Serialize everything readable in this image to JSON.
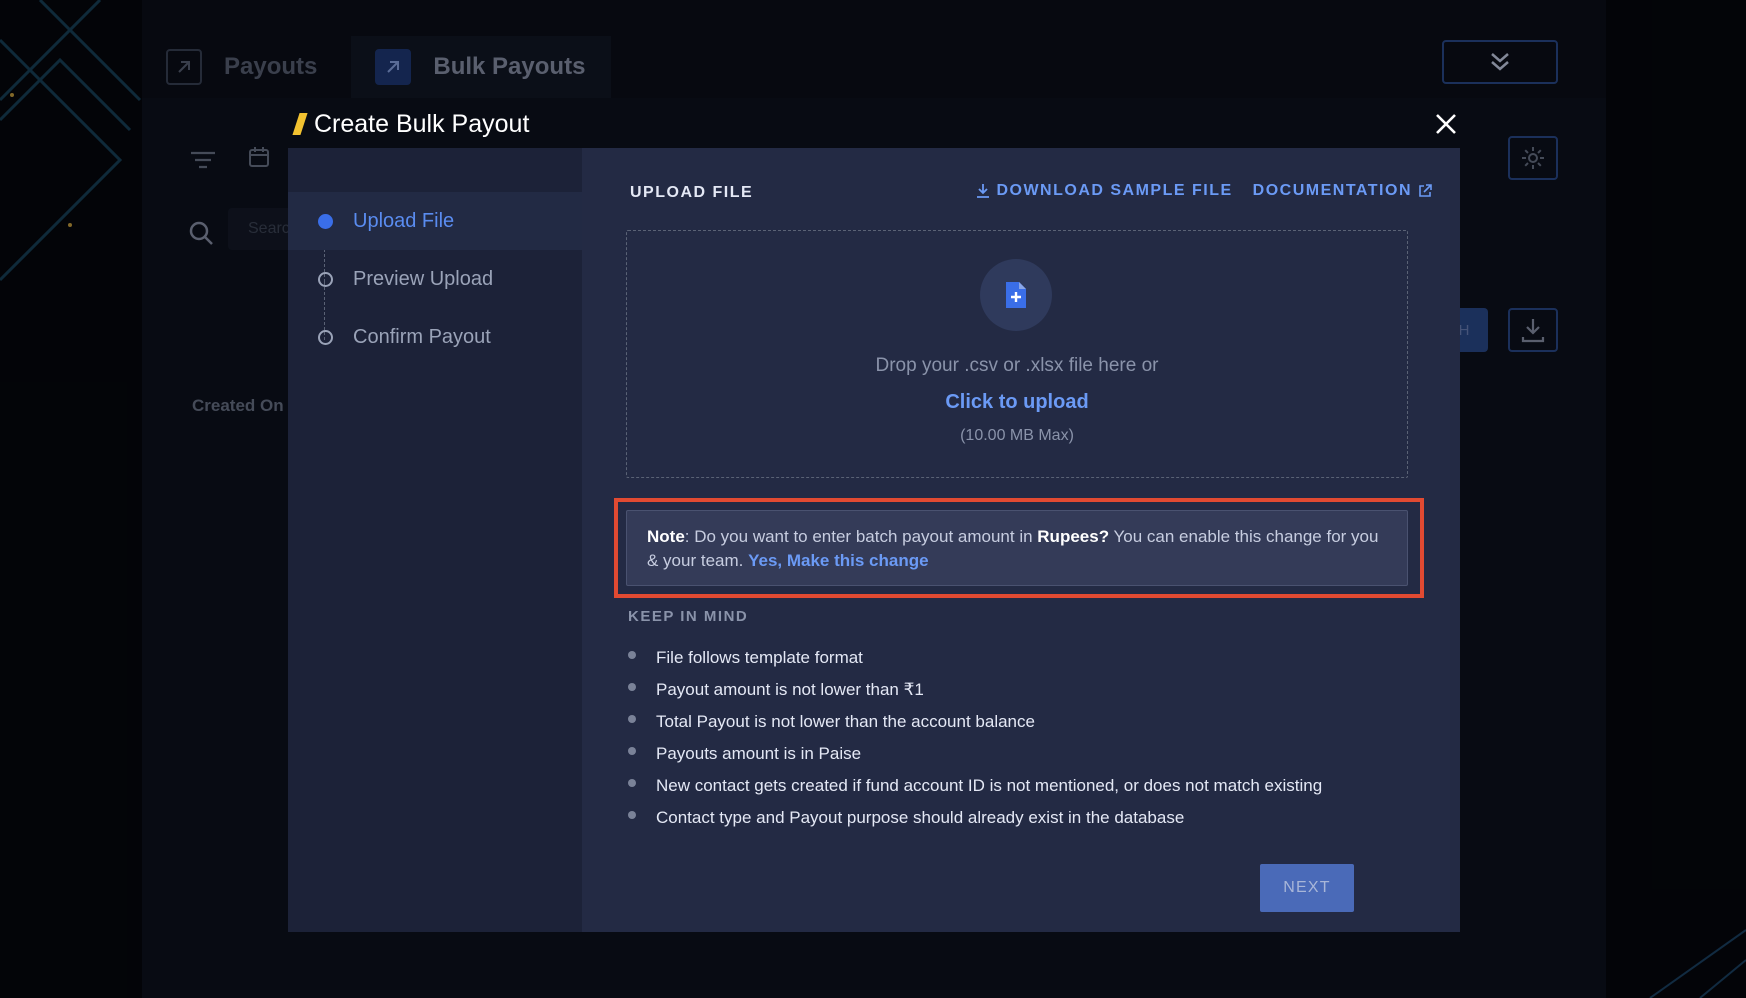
{
  "background": {
    "tabs": [
      {
        "label": "Payouts",
        "icon": "arrow-up-right-icon"
      },
      {
        "label": "Bulk Payouts",
        "icon": "arrow-up-right-icon"
      }
    ],
    "search_placeholder": "Search",
    "created_on_label": "Created On",
    "blue_button_fragment": "H"
  },
  "modal": {
    "title": "Create Bulk Payout",
    "accent_color": "#f2c230",
    "steps": [
      {
        "label": "Upload File",
        "active": true
      },
      {
        "label": "Preview Upload",
        "active": false
      },
      {
        "label": "Confirm Payout",
        "active": false
      }
    ],
    "upload_heading": "UPLOAD FILE",
    "download_sample_label": "DOWNLOAD SAMPLE FILE",
    "documentation_label": "DOCUMENTATION",
    "dropzone": {
      "drop_text": "Drop your .csv or .xlsx file here or",
      "click_text": "Click to upload",
      "max_text": "(10.00 MB Max)"
    },
    "note": {
      "label": "Note",
      "text_before": ": Do you want to enter batch payout amount in ",
      "bold_word": "Rupees?",
      "text_after": " You can enable this change for you & your team.",
      "link_text": "Yes, Make this change"
    },
    "keep_in_mind_heading": "KEEP IN MIND",
    "keep_in_mind_items": [
      "File follows template format",
      "Payout amount is not lower than ₹1",
      "Total Payout is not lower than the account balance",
      "Payouts amount is in Paise",
      "New contact gets created if fund account ID is not mentioned, or does not match existing",
      "Contact type and Payout purpose should already exist in the database"
    ],
    "next_label": "NEXT",
    "link_color": "#6b9af5",
    "highlight_color": "#e14a32"
  }
}
